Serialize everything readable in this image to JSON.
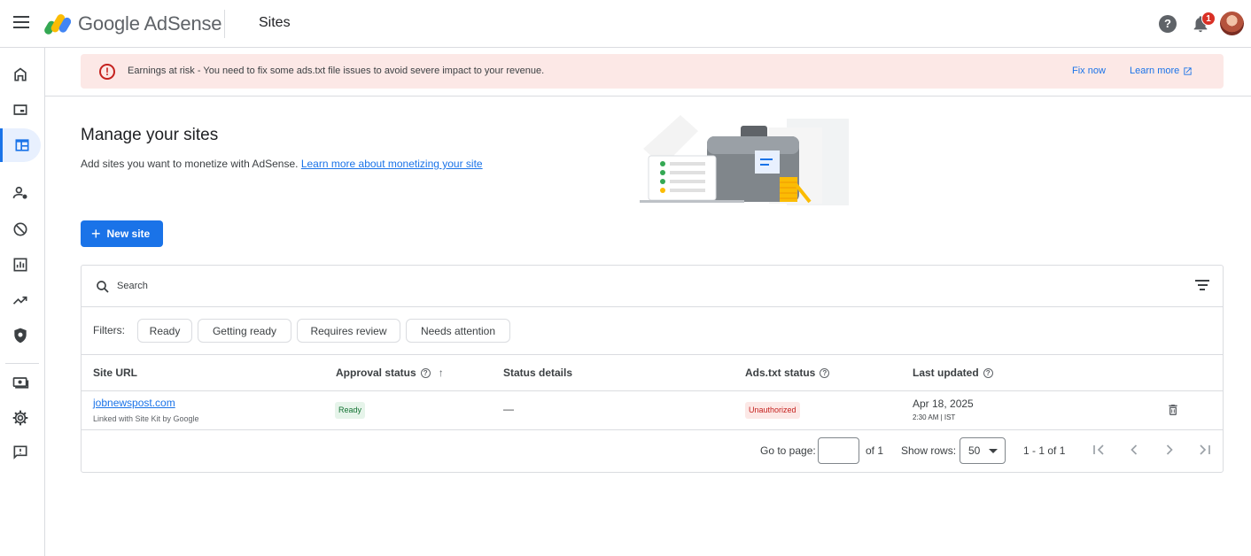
{
  "header": {
    "brand": "Google AdSense",
    "page_title": "Sites",
    "help_label": "?",
    "notification_count": "1"
  },
  "sidenav": {
    "items": [
      "home-icon",
      "ads-icon",
      "sites-icon",
      "privacy-messaging-icon",
      "blocking-controls-icon",
      "reports-icon",
      "optimization-icon",
      "policy-center-icon",
      "payments-icon",
      "settings-icon",
      "feedback-icon"
    ],
    "active_index": 2
  },
  "alert": {
    "icon": "!",
    "message": "Earnings at risk - You need to fix some ads.txt file issues to avoid severe impact to your revenue.",
    "fix_label": "Fix now",
    "learn_label": "Learn more"
  },
  "main": {
    "title": "Manage your sites",
    "subtitle": "Add sites you want to monetize with AdSense.",
    "subtitle_link": "Learn more about monetizing your site",
    "new_site_label": "New site"
  },
  "table": {
    "search_placeholder": "Search",
    "filters_label": "Filters:",
    "filter_chips": [
      "Ready",
      "Getting ready",
      "Requires review",
      "Needs attention"
    ],
    "columns": {
      "site_url": "Site URL",
      "approval_status": "Approval status",
      "status_details": "Status details",
      "ads_txt_status": "Ads.txt status",
      "last_updated": "Last updated"
    },
    "rows": [
      {
        "site": "jobnewspost.com",
        "site_sub": "Linked with Site Kit by Google",
        "approval": "Ready",
        "details": "—",
        "ads_txt": "Unauthorized",
        "date": "Apr 18, 2025",
        "time": "2:30 AM | IST"
      }
    ],
    "pagination": {
      "go_to_page_label": "Go to page:",
      "of_label": "of 1",
      "show_rows_label": "Show rows:",
      "rows_value": "50",
      "range_label": "1 - 1 of 1"
    }
  },
  "colors": {
    "accent": "#1a73e8",
    "alert_bg": "#fce8e6",
    "error": "#c5221f",
    "success_bg": "#e6f4ea",
    "success": "#137333"
  }
}
